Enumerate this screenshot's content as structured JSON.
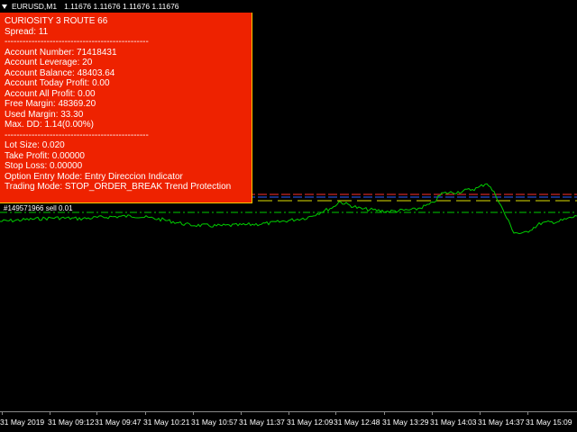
{
  "header": {
    "symbol": "EURUSD,M1",
    "prices": "1.11676 1.11676 1.11676 1.11676"
  },
  "info_panel": {
    "lines": [
      "CURIOSITY 3 ROUTE 66",
      "Spread: 11",
      "------------------------------------------------",
      "Account Number: 71418431",
      "Account Leverage: 20",
      "Account Balance: 48403.64",
      "Account Today Profit: 0.00",
      "Account All Profit: 0.00",
      "Free Margin: 48369.20",
      "Used Margin: 33.30",
      "Max. DD: 1.14(0.00%)",
      "------------------------------------------------",
      "Lot Size: 0.020",
      "Take Profit: 0.00000",
      "Stop Loss: 0.00000",
      "Option Entry Mode:  Entry Direccion Indicator",
      "Trading Mode: STOP_ORDER_BREAK Trend Protection"
    ]
  },
  "order_label": "#149571966 sell 0.01",
  "time_axis": {
    "labels": [
      "31 May 2019",
      "31 May 09:12",
      "31 May 09:47",
      "31 May 10:21",
      "31 May 10:57",
      "31 May 11:37",
      "31 May 12:09",
      "31 May 12:48",
      "31 May 13:29",
      "31 May 14:03",
      "31 May 14:37",
      "31 May 15:09"
    ]
  },
  "colors": {
    "panel_bg": "#ee2200",
    "panel_border": "#ffcc00",
    "price_line": "#00cc00",
    "order_line": "#00cc00",
    "level_red": "#ff3030",
    "level_blue": "#3060ff",
    "level_yellow": "#e0e000"
  },
  "icons": {
    "dropdown": "triangle-down-icon"
  }
}
